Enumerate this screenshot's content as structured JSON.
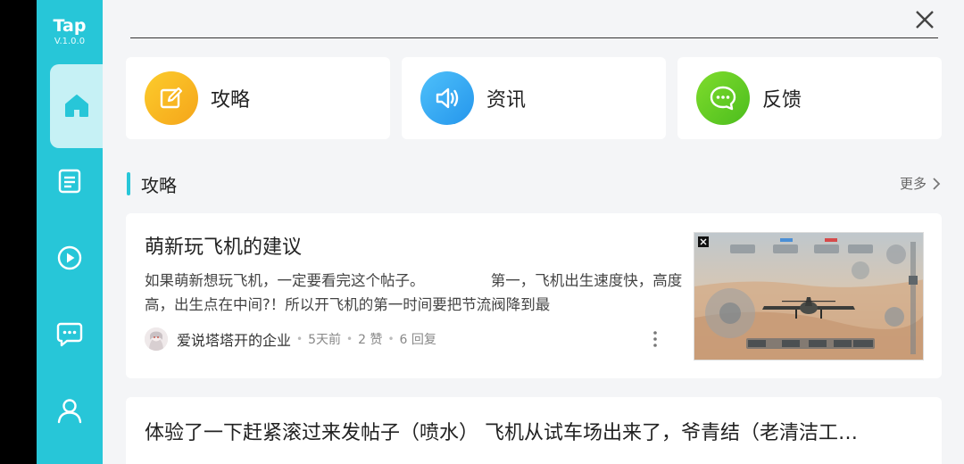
{
  "app": {
    "logo": "Tap",
    "version": "V.1.0.0"
  },
  "sidebar": {
    "items": [
      {
        "name": "home",
        "icon": "home-icon",
        "active": true
      },
      {
        "name": "articles",
        "icon": "document-icon",
        "active": false
      },
      {
        "name": "videos",
        "icon": "play-icon",
        "active": false
      },
      {
        "name": "messages",
        "icon": "chat-icon",
        "active": false
      },
      {
        "name": "profile",
        "icon": "user-icon",
        "active": false
      }
    ]
  },
  "quick_links": [
    {
      "label": "攻略",
      "icon": "edit-icon",
      "color": "#f7b21c"
    },
    {
      "label": "资讯",
      "icon": "speaker-icon",
      "color": "#2ea9f4"
    },
    {
      "label": "反馈",
      "icon": "chat-bubble-icon",
      "color": "#62cc24"
    }
  ],
  "section": {
    "title": "攻略",
    "more": "更多"
  },
  "posts": [
    {
      "title": "萌新玩飞机的建议",
      "body": "如果萌新想玩飞机，一定要看完这个帖子。　　　　　第一，飞机出生速度快，高度高，出生点在中间?！所以开飞机的第一时间要把节流阀降到最",
      "author": "爱说塔塔开的企业",
      "time": "5天前",
      "likes": "2 赞",
      "replies": "6 回复"
    },
    {
      "title": "体验了一下赶紧滚过来发帖子（喷水） 飞机从试车场出来了，爷青结（老清洁工…"
    }
  ],
  "colors": {
    "accent": "#27c6d8",
    "background": "#f4f5f7"
  }
}
